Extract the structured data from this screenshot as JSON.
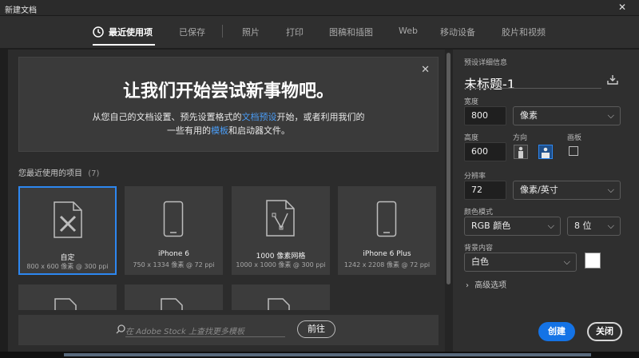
{
  "window": {
    "title": "新建文档",
    "close": "✕"
  },
  "tabs": [
    {
      "label": "最近使用项",
      "active": true
    },
    {
      "label": "已保存"
    },
    {
      "label": "照片"
    },
    {
      "label": "打印"
    },
    {
      "label": "图稿和插图"
    },
    {
      "label": "Web"
    },
    {
      "label": "移动设备"
    },
    {
      "label": "胶片和视频"
    }
  ],
  "banner": {
    "headline": "让我们开始尝试新事物吧。",
    "line1_pre": "从您自己的文档设置、预先设置格式的",
    "line1_link": "文档预设",
    "line1_post": "开始，或者利用我们的",
    "line2_pre": "一些有用的",
    "line2_link": "模板",
    "line2_post": "和启动器文件。",
    "close": "✕"
  },
  "recent": {
    "label": "您最近使用的项目",
    "count": "(7)",
    "items": [
      {
        "name": "自定",
        "size": "800 x 600 像素 @ 300 ppi",
        "icon": "custom-doc-icon"
      },
      {
        "name": "iPhone 6",
        "size": "750 x 1334 像素 @ 72 ppi",
        "icon": "phone-icon"
      },
      {
        "name": "1000 像素网格",
        "size": "1000 x 1000 像素 @ 300 ppi",
        "icon": "grid-doc-icon"
      },
      {
        "name": "iPhone 6 Plus",
        "size": "1242 x 2208 像素 @ 72 ppi",
        "icon": "phone-icon"
      }
    ]
  },
  "search": {
    "placeholder": "在 Adobe Stock 上查找更多模板",
    "button": "前往"
  },
  "details": {
    "section_label": "预设详细信息",
    "doc_title": "未标题-1",
    "width_label": "宽度",
    "width_value": "800",
    "width_unit": "像素",
    "height_label": "高度",
    "height_value": "600",
    "orientation_label": "方向",
    "artboard_label": "画板",
    "resolution_label": "分辨率",
    "resolution_value": "72",
    "resolution_unit": "像素/英寸",
    "color_mode_label": "颜色模式",
    "color_mode_value": "RGB 颜色",
    "bit_depth_value": "8 位",
    "background_label": "背景内容",
    "background_value": "白色",
    "background_color": "#ffffff",
    "advanced": "高级选项"
  },
  "actions": {
    "create": "创建",
    "close": "关闭"
  },
  "colors": {
    "accent": "#1473e6",
    "link": "#4a9cf5",
    "selected_border": "#2d87f0"
  }
}
